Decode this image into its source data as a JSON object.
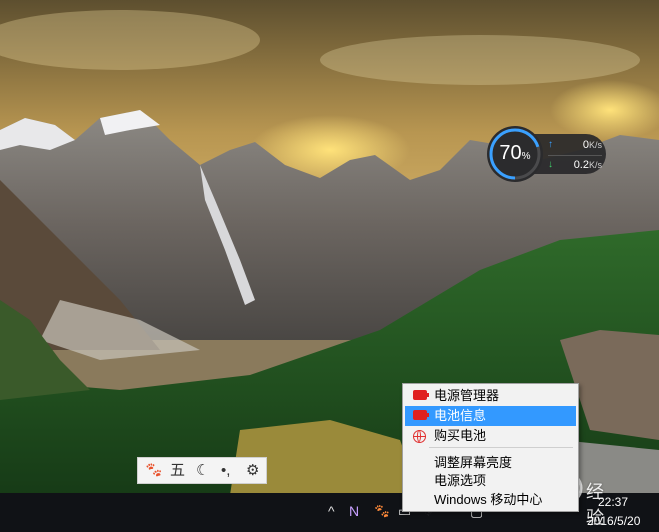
{
  "speed_widget": {
    "percent": "70",
    "percent_unit": "%",
    "upload_value": "0",
    "download_value": "0.2",
    "speed_unit": "K/s",
    "accent_color": "#3aa0ff",
    "progress": 0.7
  },
  "ime_toolbar": {
    "items": [
      "paw-icon",
      "五",
      "moon-icon",
      "punctuation-icon",
      "gear-icon"
    ],
    "mode_label": "五"
  },
  "context_menu": {
    "items": [
      {
        "label": "电源管理器",
        "icon": "battery-icon",
        "selected": false
      },
      {
        "label": "电池信息",
        "icon": "battery-icon",
        "selected": true
      },
      {
        "label": "购买电池",
        "icon": "globe-icon",
        "selected": false
      },
      {
        "label": "调整屏幕亮度",
        "icon": "",
        "selected": false
      },
      {
        "label": "电源选项",
        "icon": "",
        "selected": false
      },
      {
        "label": "Windows 移动中心",
        "icon": "",
        "selected": false
      }
    ],
    "highlight_color": "#3399ff"
  },
  "taskbar": {
    "time": "22:37",
    "date": "2016/5/20",
    "tray_icons": [
      "chevron-up-icon",
      "onenote-icon",
      "input-method-icon",
      "battery-icon",
      "network-icon",
      "message-icon"
    ]
  },
  "watermark": {
    "text": "经验"
  }
}
